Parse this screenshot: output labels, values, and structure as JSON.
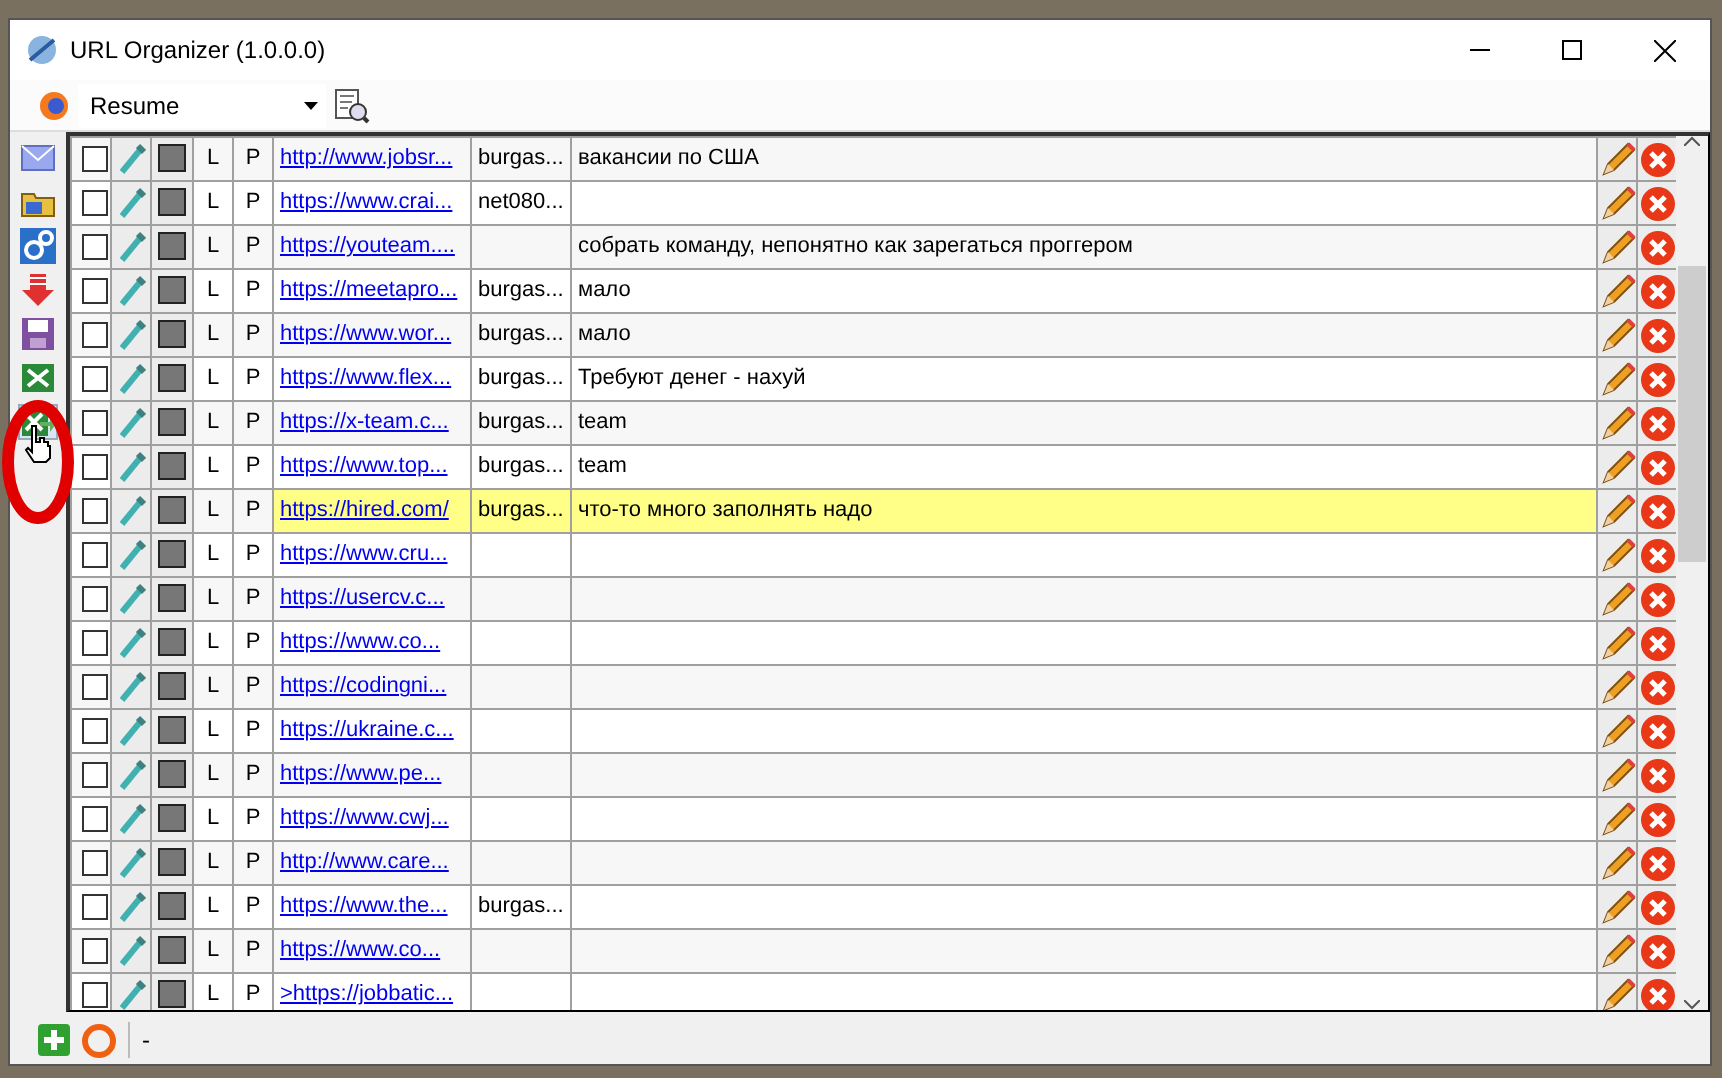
{
  "window": {
    "title": "URL Organizer (1.0.0.0)"
  },
  "toolbar": {
    "profile": "Resume"
  },
  "side_tools": [
    {
      "kind": "mail",
      "hovered": false
    },
    {
      "kind": "folder",
      "hovered": false
    },
    {
      "kind": "gears",
      "hovered": false
    },
    {
      "kind": "download",
      "hovered": false
    },
    {
      "kind": "save",
      "hovered": false
    },
    {
      "kind": "sheet",
      "hovered": false
    },
    {
      "kind": "sheet-export",
      "hovered": true
    }
  ],
  "rows": [
    {
      "checked": false,
      "l": "L",
      "p": "P",
      "url": "http://www.jobsr...",
      "user": "burgas...",
      "note": "вакансии по США",
      "highlighted": false
    },
    {
      "checked": false,
      "l": "L",
      "p": "P",
      "url": "https://www.crai...",
      "user": "net080...",
      "note": "",
      "highlighted": false
    },
    {
      "checked": false,
      "l": "L",
      "p": "P",
      "url": "https://youteam....",
      "user": "",
      "note": "собрать команду, непонятно как зарегаться проггером",
      "highlighted": false
    },
    {
      "checked": false,
      "l": "L",
      "p": "P",
      "url": "https://meetapro...",
      "user": "burgas...",
      "note": "мало",
      "highlighted": false
    },
    {
      "checked": false,
      "l": "L",
      "p": "P",
      "url": "https://www.wor...",
      "user": "burgas...",
      "note": "мало",
      "highlighted": false
    },
    {
      "checked": false,
      "l": "L",
      "p": "P",
      "url": "https://www.flex...",
      "user": "burgas...",
      "note": "Требуют денег - нахуй",
      "highlighted": false
    },
    {
      "checked": false,
      "l": "L",
      "p": "P",
      "url": "https://x-team.c...",
      "user": "burgas...",
      "note": "team",
      "highlighted": false
    },
    {
      "checked": false,
      "l": "L",
      "p": "P",
      "url": "https://www.top...",
      "user": "burgas...",
      "note": "team",
      "highlighted": false
    },
    {
      "checked": false,
      "l": "L",
      "p": "P",
      "url": "https://hired.com/",
      "user": "burgas...",
      "note": "что-то много заполнять надо",
      "highlighted": true
    },
    {
      "checked": false,
      "l": "L",
      "p": "P",
      "url": "https://www.cru...",
      "user": "",
      "note": "",
      "highlighted": false
    },
    {
      "checked": false,
      "l": "L",
      "p": "P",
      "url": "https://usercv.c...",
      "user": "",
      "note": "",
      "highlighted": false
    },
    {
      "checked": false,
      "l": "L",
      "p": "P",
      "url": "https://www.co...",
      "user": "",
      "note": "",
      "highlighted": false
    },
    {
      "checked": false,
      "l": "L",
      "p": "P",
      "url": "https://codingni...",
      "user": "",
      "note": "",
      "highlighted": false
    },
    {
      "checked": false,
      "l": "L",
      "p": "P",
      "url": "https://ukraine.c...",
      "user": "",
      "note": "",
      "highlighted": false
    },
    {
      "checked": false,
      "l": "L",
      "p": "P",
      "url": "https://www.pe...",
      "user": "",
      "note": "",
      "highlighted": false
    },
    {
      "checked": false,
      "l": "L",
      "p": "P",
      "url": "https://www.cwj...",
      "user": "",
      "note": "",
      "highlighted": false
    },
    {
      "checked": false,
      "l": "L",
      "p": "P",
      "url": "http://www.care...",
      "user": "",
      "note": "",
      "highlighted": false
    },
    {
      "checked": false,
      "l": "L",
      "p": "P",
      "url": "https://www.the...",
      "user": "burgas...",
      "note": "",
      "highlighted": false
    },
    {
      "checked": false,
      "l": "L",
      "p": "P",
      "url": "https://www.co...",
      "user": "",
      "note": "",
      "highlighted": false
    },
    {
      "checked": false,
      "l": "L",
      "p": "P",
      "url": ">https://jobbatic...",
      "user": "",
      "note": "",
      "highlighted": false
    }
  ],
  "status_bar": {
    "text": "-"
  }
}
